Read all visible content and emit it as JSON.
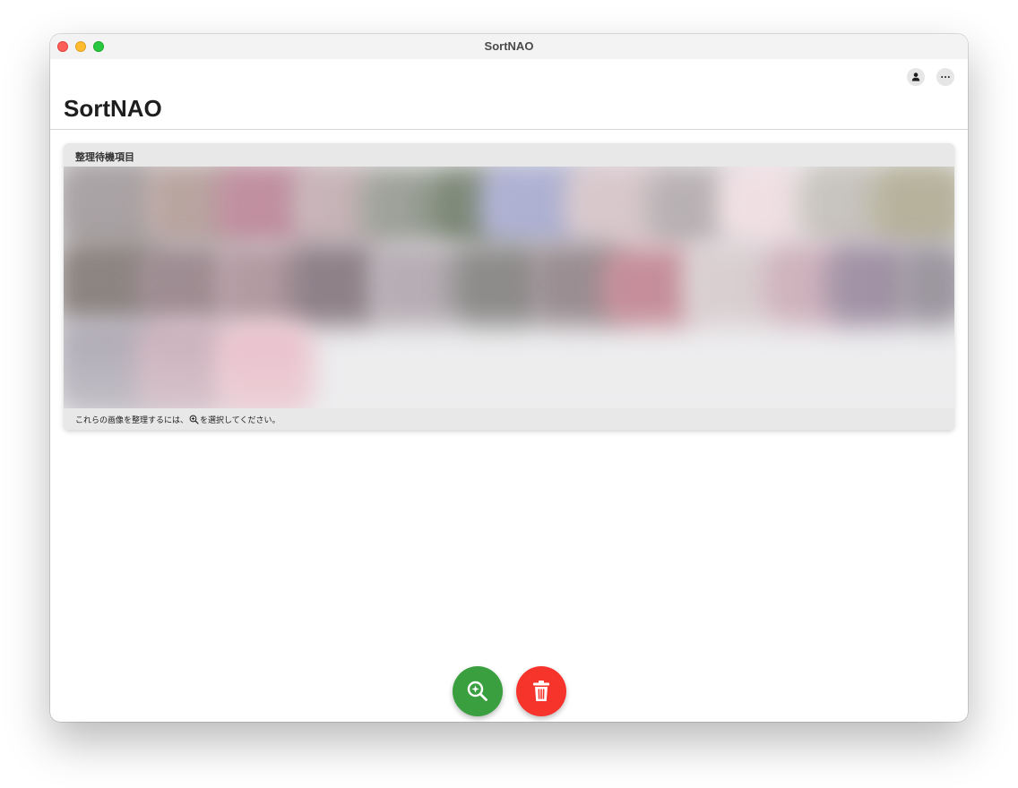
{
  "window": {
    "title": "SortNAO"
  },
  "header": {
    "app_title": "SortNAO",
    "actions": [
      {
        "name": "account",
        "icon": "person-icon"
      },
      {
        "name": "more",
        "icon": "more-horizontal-icon"
      }
    ]
  },
  "pending_card": {
    "title": "整理待機項目",
    "footer_prefix": "これらの画像を整理するには、",
    "footer_icon": "zoom-in-icon",
    "footer_suffix": "を選択してください。"
  },
  "fabs": [
    {
      "name": "organize",
      "icon": "zoom-in-icon",
      "color": "#3a9f3e"
    },
    {
      "name": "delete",
      "icon": "trash-icon",
      "color": "#f6342b"
    }
  ],
  "colors": {
    "titlebar": "#f3f3f3",
    "card_background": "#e8e8e8",
    "organize_button": "#3a9f3e",
    "delete_button": "#f6342b"
  }
}
